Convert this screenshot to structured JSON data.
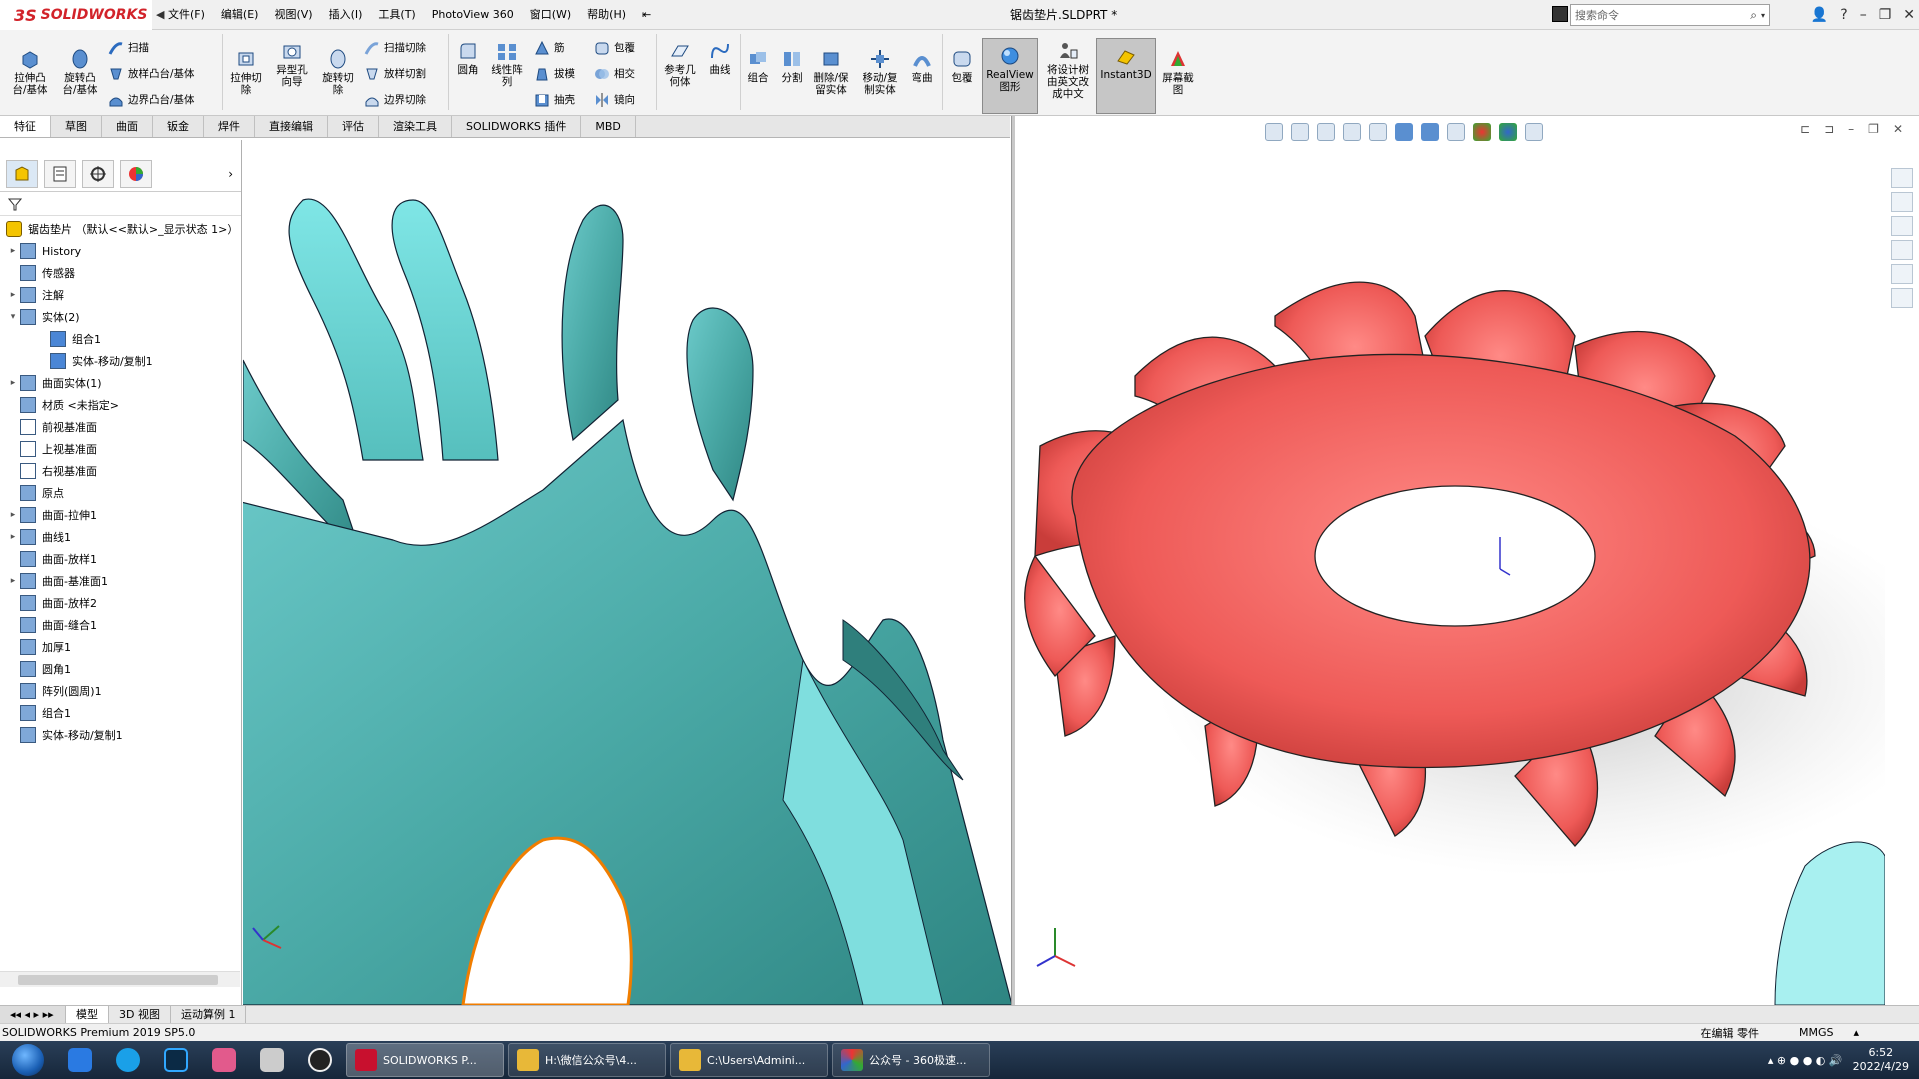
{
  "app": {
    "brand_ds": "3S",
    "brand_name": "SOLIDWORKS",
    "document_title": "锯齿垫片.SLDPRT *",
    "search_placeholder": "搜索命令"
  },
  "menu": [
    "文件(F)",
    "编辑(E)",
    "视图(V)",
    "插入(I)",
    "工具(T)",
    "PhotoView 360",
    "窗口(W)",
    "帮助(H)"
  ],
  "toolbar": {
    "extrude_boss": "拉伸凸\n台/基体",
    "revolve_boss": "旋转凸\n台/基体",
    "sweep": "扫描",
    "loft_boss": "放样凸台/基体",
    "boundary_boss": "边界凸台/基体",
    "extrude_cut": "拉伸切\n除",
    "hole_wizard": "异型孔\n向导",
    "revolve_cut": "旋转切\n除",
    "swept_cut": "扫描切除",
    "lofted_cut": "放样切割",
    "boundary_cut": "边界切除",
    "fillet": "圆角",
    "linear_pattern": "线性阵\n列",
    "rib": "筋",
    "draft": "拔模",
    "shell": "抽壳",
    "wrap": "包覆",
    "intersect": "相交",
    "mirror": "镜向",
    "ref_geometry": "参考几\n何体",
    "curves": "曲线",
    "combine": "组合",
    "split": "分割",
    "delete_keep_body": "删除/保\n留实体",
    "move_copy_body": "移动/复\n制实体",
    "flex": "弯曲",
    "wrap2": "包覆",
    "realview": "RealView\n图形",
    "tree_to_text": "将设计树\n由英文改\n成中文",
    "instant3d": "Instant3D",
    "screen_capture": "屏幕截\n图"
  },
  "tabs": [
    "特征",
    "草图",
    "曲面",
    "钣金",
    "焊件",
    "直接编辑",
    "评估",
    "渲染工具",
    "SOLIDWORKS 插件",
    "MBD"
  ],
  "tree": {
    "root": "锯齿垫片 （默认<<默认>_显示状态 1>）",
    "items": [
      {
        "label": "History",
        "expandable": true,
        "indent": 1,
        "icon": "history-icon"
      },
      {
        "label": "传感器",
        "expandable": false,
        "indent": 1,
        "icon": "sensor-icon"
      },
      {
        "label": "注解",
        "expandable": true,
        "indent": 1,
        "icon": "annotation-icon"
      },
      {
        "label": "实体(2)",
        "expandable": true,
        "expanded": true,
        "indent": 1,
        "icon": "solid-bodies-icon"
      },
      {
        "label": "组合1",
        "expandable": false,
        "indent": 2,
        "icon": "body-icon"
      },
      {
        "label": "实体-移动/复制1",
        "expandable": false,
        "indent": 2,
        "icon": "body-icon"
      },
      {
        "label": "曲面实体(1)",
        "expandable": true,
        "indent": 1,
        "icon": "surface-bodies-icon"
      },
      {
        "label": "材质 <未指定>",
        "expandable": false,
        "indent": 1,
        "icon": "material-icon"
      },
      {
        "label": "前视基准面",
        "expandable": false,
        "indent": 1,
        "icon": "plane-icon"
      },
      {
        "label": "上视基准面",
        "expandable": false,
        "indent": 1,
        "icon": "plane-icon"
      },
      {
        "label": "右视基准面",
        "expandable": false,
        "indent": 1,
        "icon": "plane-icon"
      },
      {
        "label": "原点",
        "expandable": false,
        "indent": 1,
        "icon": "origin-icon"
      },
      {
        "label": "曲面-拉伸1",
        "expandable": true,
        "indent": 1,
        "icon": "surface-extrude-icon"
      },
      {
        "label": "曲线1",
        "expandable": true,
        "indent": 1,
        "icon": "curve-icon"
      },
      {
        "label": "曲面-放样1",
        "expandable": false,
        "indent": 1,
        "icon": "surface-loft-icon"
      },
      {
        "label": "曲面-基准面1",
        "expandable": true,
        "indent": 1,
        "icon": "planar-surface-icon"
      },
      {
        "label": "曲面-放样2",
        "expandable": false,
        "indent": 1,
        "icon": "surface-loft-icon"
      },
      {
        "label": "曲面-缝合1",
        "expandable": false,
        "indent": 1,
        "icon": "knit-icon"
      },
      {
        "label": "加厚1",
        "expandable": false,
        "indent": 1,
        "icon": "thicken-icon"
      },
      {
        "label": "圆角1",
        "expandable": false,
        "indent": 1,
        "icon": "fillet-icon"
      },
      {
        "label": "阵列(圆周)1",
        "expandable": false,
        "indent": 1,
        "icon": "circular-pattern-icon"
      },
      {
        "label": "组合1",
        "expandable": false,
        "indent": 1,
        "icon": "combine-icon"
      },
      {
        "label": "实体-移动/复制1",
        "expandable": false,
        "indent": 1,
        "icon": "move-copy-icon"
      }
    ]
  },
  "bottom_tabs": [
    "模型",
    "3D 视图",
    "运动算例 1"
  ],
  "status": {
    "left": "SOLIDWORKS Premium 2019 SP5.0",
    "editing": "在编辑 零件",
    "units": "MMGS"
  },
  "taskbar": {
    "windows": [
      {
        "label": "SOLIDWORKS P...",
        "active": true
      },
      {
        "label": "H:\\微信公众号\\4...",
        "active": false
      },
      {
        "label": "C:\\Users\\Admini...",
        "active": false
      },
      {
        "label": "公众号 - 360极速...",
        "active": false
      }
    ],
    "time": "6:52",
    "date": "2022/4/29"
  },
  "colors": {
    "teal_body": "#4fb3b0",
    "red_body": "#ee5a57",
    "selection_edge": "#f07d00",
    "brand_red": "#d2232a"
  }
}
